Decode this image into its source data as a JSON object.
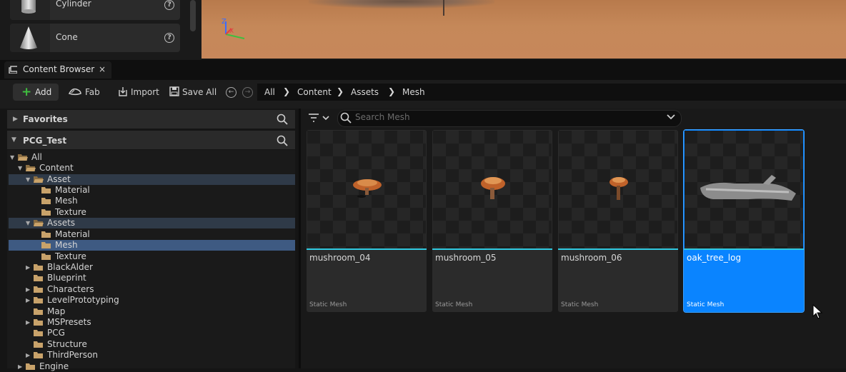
{
  "place_actors": {
    "items": [
      {
        "label": "Cylinder",
        "help": "?"
      },
      {
        "label": "Cone",
        "help": "?"
      }
    ]
  },
  "viewport": {
    "axis_labels": {
      "z": "Z",
      "x": "X"
    }
  },
  "content_browser_tab": {
    "title": "Content Browser",
    "close": "×"
  },
  "toolbar": {
    "add_label": "Add",
    "fab_label": "Fab",
    "import_label": "Import",
    "save_all_label": "Save All",
    "breadcrumb": [
      "All",
      "Content",
      "Assets",
      "Mesh"
    ],
    "separator": "❯"
  },
  "sidebar": {
    "favorites_title": "Favorites",
    "project_title": "PCG_Test",
    "tree": [
      {
        "label": "All",
        "expanded": true
      },
      {
        "label": "Content",
        "expanded": true
      },
      {
        "label": "Asset",
        "expanded": true
      },
      {
        "label": "Material"
      },
      {
        "label": "Mesh"
      },
      {
        "label": "Texture"
      },
      {
        "label": "Assets",
        "expanded": true
      },
      {
        "label": "Material"
      },
      {
        "label": "Mesh",
        "selected": true
      },
      {
        "label": "Texture"
      },
      {
        "label": "BlackAlder",
        "collapsed": true
      },
      {
        "label": "Blueprint"
      },
      {
        "label": "Characters",
        "collapsed": true
      },
      {
        "label": "LevelPrototyping",
        "collapsed": true
      },
      {
        "label": "Map"
      },
      {
        "label": "MSPresets",
        "collapsed": true
      },
      {
        "label": "PCG"
      },
      {
        "label": "Structure"
      },
      {
        "label": "ThirdPerson",
        "collapsed": true
      },
      {
        "label": "Engine",
        "collapsed": true
      }
    ]
  },
  "search": {
    "placeholder": "Search Mesh"
  },
  "assets": [
    {
      "name": "mushroom_04",
      "type": "Static Mesh",
      "selected": false
    },
    {
      "name": "mushroom_05",
      "type": "Static Mesh",
      "selected": false
    },
    {
      "name": "mushroom_06",
      "type": "Static Mesh",
      "selected": false
    },
    {
      "name": "oak_tree_log",
      "type": "Static Mesh",
      "selected": true
    }
  ],
  "colors": {
    "selection_blue": "#0a84ff",
    "asset_bar_cyan": "#2fc9e0",
    "add_green": "#3fbf3f",
    "folder_tan": "#c8a26a"
  }
}
